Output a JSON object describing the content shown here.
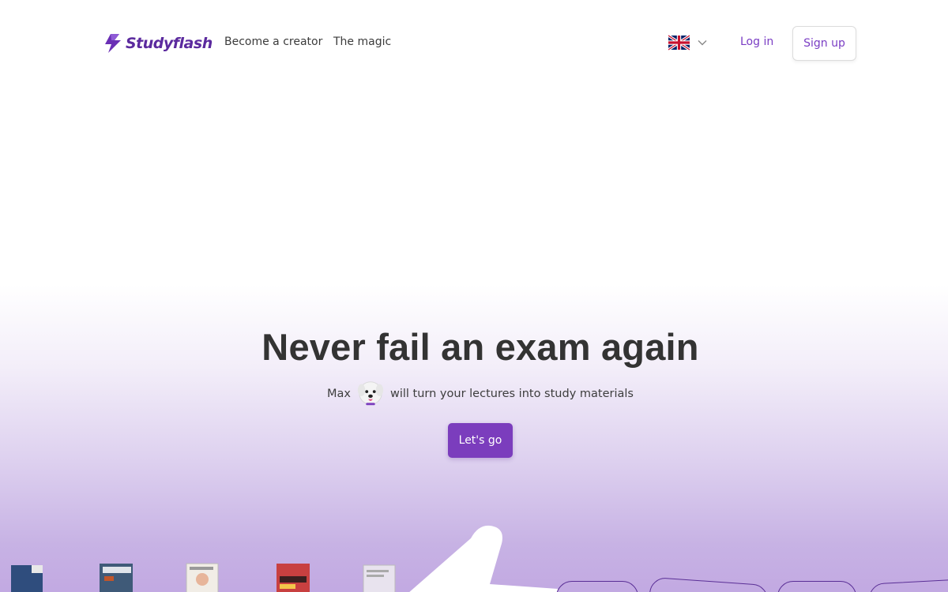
{
  "brand": {
    "name": "Studyflash",
    "color": "#5b2a9e"
  },
  "nav": {
    "items": [
      {
        "label": "Become a creator"
      },
      {
        "label": "The magic"
      }
    ]
  },
  "language": {
    "selected_icon": "uk-flag-icon"
  },
  "auth": {
    "login_label": "Log in",
    "signup_label": "Sign up"
  },
  "hero": {
    "title": "Never fail an exam again",
    "subtitle_before": "Max",
    "subtitle_after": "will turn your lectures into study materials",
    "mascot_icon": "dog-mascot-icon",
    "cta_label": "Let's go"
  },
  "colors": {
    "accent": "#7b3dbd",
    "link": "#7a3dc4",
    "text": "#333333"
  }
}
